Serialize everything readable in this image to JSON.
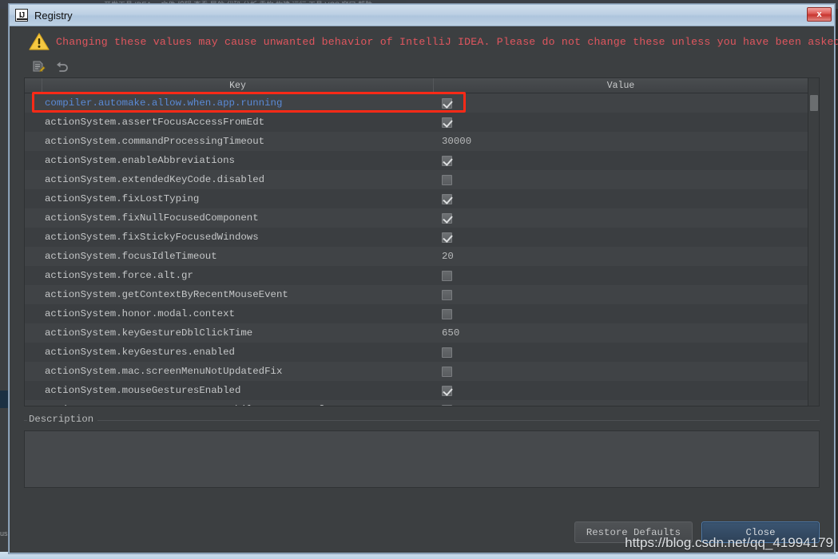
{
  "background": {
    "top_ghost_text": "开发工具  IDEA ...  文件  编辑  查看  导航  代码  分析  重构  构建  运行  工具  VCS  窗口  帮助",
    "left_label": "us",
    "accent_dialog_border": "#9db5cc",
    "ide_background": "#2b2b2b"
  },
  "window": {
    "title": "Registry",
    "logo_text": "IJ",
    "close_glyph": "x",
    "close_name": "close-window-button"
  },
  "warning": {
    "icon": "warning-triangle-icon",
    "text": "Changing these values may cause unwanted behavior of IntelliJ IDEA. Please do not change these unless you have been asked.",
    "color": "#e0565e"
  },
  "toolbar": {
    "buttons": [
      {
        "name": "edit-value-icon",
        "title": "Edit Value"
      },
      {
        "name": "revert-to-default-icon",
        "title": "Revert to Default"
      }
    ]
  },
  "table": {
    "headers": {
      "gutter": "",
      "key": "Key",
      "value": "Value"
    },
    "rows": [
      {
        "key": "compiler.automake.allow.when.app.running",
        "type": "checkbox",
        "checked": true,
        "modified": true
      },
      {
        "key": "actionSystem.assertFocusAccessFromEdt",
        "type": "checkbox",
        "checked": true,
        "modified": false
      },
      {
        "key": "actionSystem.commandProcessingTimeout",
        "type": "text",
        "value": "30000",
        "modified": false
      },
      {
        "key": "actionSystem.enableAbbreviations",
        "type": "checkbox",
        "checked": true,
        "modified": false
      },
      {
        "key": "actionSystem.extendedKeyCode.disabled",
        "type": "checkbox",
        "checked": false,
        "modified": false
      },
      {
        "key": "actionSystem.fixLostTyping",
        "type": "checkbox",
        "checked": true,
        "modified": false
      },
      {
        "key": "actionSystem.fixNullFocusedComponent",
        "type": "checkbox",
        "checked": true,
        "modified": false
      },
      {
        "key": "actionSystem.fixStickyFocusedWindows",
        "type": "checkbox",
        "checked": true,
        "modified": false
      },
      {
        "key": "actionSystem.focusIdleTimeout",
        "type": "text",
        "value": "20",
        "modified": false
      },
      {
        "key": "actionSystem.force.alt.gr",
        "type": "checkbox",
        "checked": false,
        "modified": false
      },
      {
        "key": "actionSystem.getContextByRecentMouseEvent",
        "type": "checkbox",
        "checked": false,
        "modified": false
      },
      {
        "key": "actionSystem.honor.modal.context",
        "type": "checkbox",
        "checked": false,
        "modified": false
      },
      {
        "key": "actionSystem.keyGestureDblClickTime",
        "type": "text",
        "value": "650",
        "modified": false
      },
      {
        "key": "actionSystem.keyGestures.enabled",
        "type": "checkbox",
        "checked": false,
        "modified": false
      },
      {
        "key": "actionSystem.mac.screenMenuNotUpdatedFix",
        "type": "checkbox",
        "checked": false,
        "modified": false
      },
      {
        "key": "actionSystem.mouseGesturesEnabled",
        "type": "checkbox",
        "checked": true,
        "modified": false
      },
      {
        "key": "actionSystem.noContextComponentWhileFocusTransfer",
        "type": "checkbox",
        "checked": true,
        "modified": false
      }
    ],
    "annotation": {
      "name": "red-highlight-box",
      "color": "#fa2a17",
      "target_row": 0
    }
  },
  "description": {
    "legend": "Description",
    "content": ""
  },
  "footer": {
    "restore_defaults_label": "Restore Defaults",
    "close_label": "Close"
  },
  "watermark": {
    "text": "https://blog.csdn.net/qq_41994179"
  }
}
